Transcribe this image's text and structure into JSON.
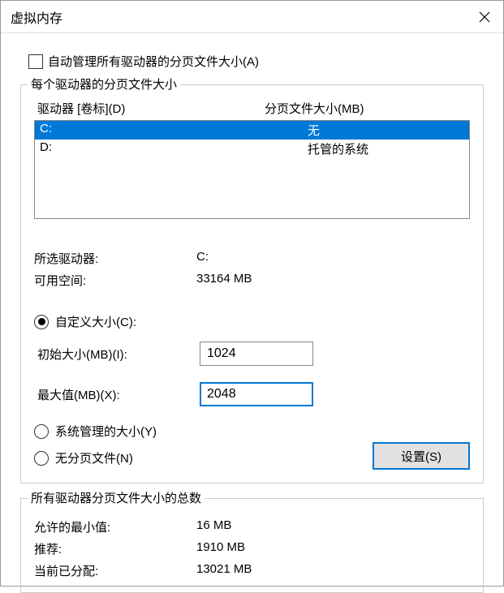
{
  "window": {
    "title": "虚拟内存"
  },
  "auto_manage": {
    "label": "自动管理所有驱动器的分页文件大小(A)"
  },
  "drives_group": {
    "legend": "每个驱动器的分页文件大小",
    "col_drive": "驱动器 [卷标](D)",
    "col_size": "分页文件大小(MB)",
    "rows": [
      {
        "drive": "C:",
        "size": "无"
      },
      {
        "drive": "D:",
        "size": "托管的系统"
      }
    ],
    "selected_drive_label": "所选驱动器:",
    "selected_drive_value": "C:",
    "available_label": "可用空间:",
    "available_value": "33164 MB",
    "custom_size_label": "自定义大小(C):",
    "initial_label": "初始大小(MB)(I):",
    "initial_value": "1024",
    "max_label": "最大值(MB)(X):",
    "max_value": "2048",
    "system_managed_label": "系统管理的大小(Y)",
    "no_paging_label": "无分页文件(N)",
    "set_button": "设置(S)"
  },
  "totals_group": {
    "legend": "所有驱动器分页文件大小的总数",
    "min_label": "允许的最小值:",
    "min_value": "16 MB",
    "rec_label": "推荐:",
    "rec_value": "1910 MB",
    "cur_label": "当前已分配:",
    "cur_value": "13021 MB"
  }
}
